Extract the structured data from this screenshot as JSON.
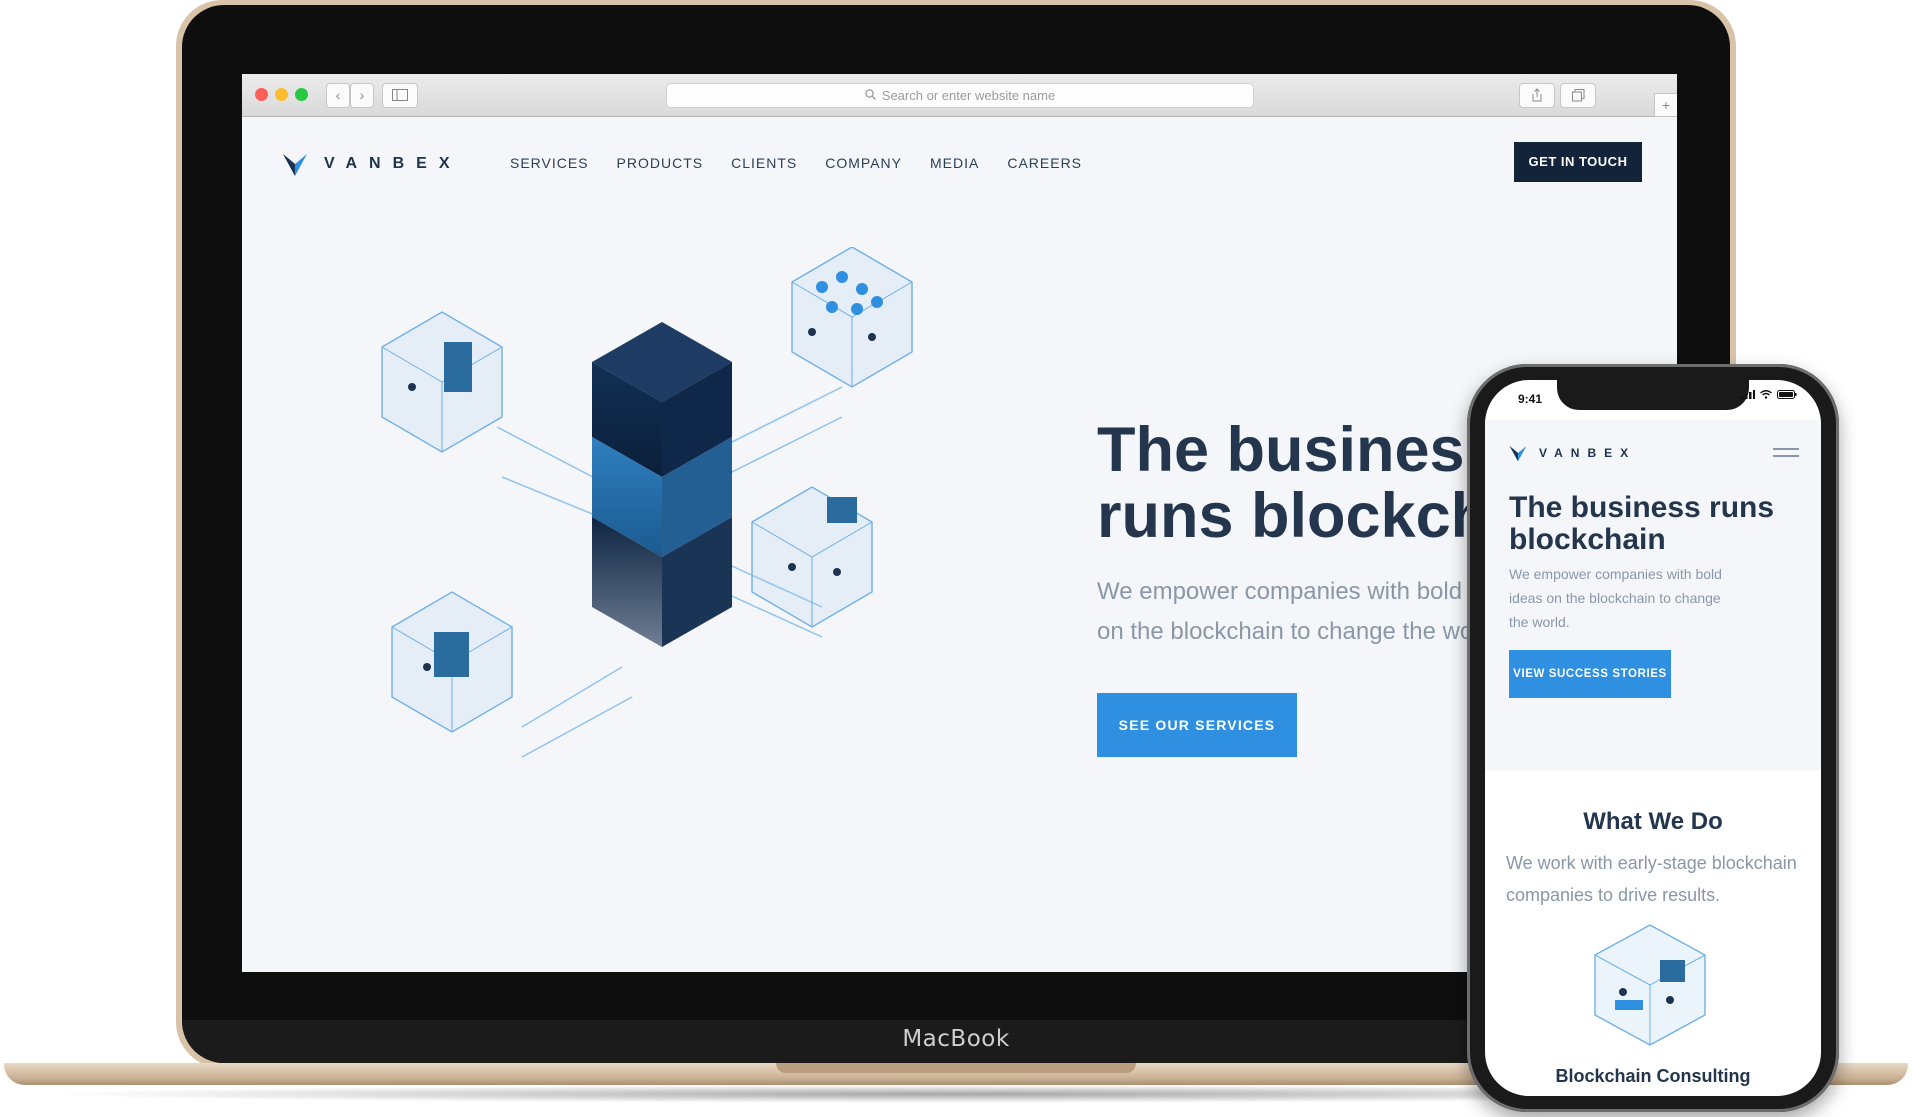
{
  "device": {
    "laptop_brand": "MacBook"
  },
  "browser": {
    "url_placeholder": "Search or enter website name",
    "traffic_lights": [
      "#fc5f57",
      "#fdbc2e",
      "#28c840"
    ]
  },
  "site": {
    "logo_text": "VANBEX",
    "nav": [
      "SERVICES",
      "PRODUCTS",
      "CLIENTS",
      "COMPANY",
      "MEDIA",
      "CAREERS"
    ],
    "cta_label": "GET IN TOUCH",
    "hero": {
      "title_line1": "The business",
      "title_line2": "runs blockchain",
      "subtitle_line1": "We empower companies with bold ideas",
      "subtitle_line2": "on the blockchain to change the world.",
      "button_label": "SEE OUR SERVICES"
    },
    "colors": {
      "navy": "#12233a",
      "accent": "#2f8fe0",
      "heading": "#24364d",
      "muted": "#8a97a8",
      "background": "#f4f6f9"
    }
  },
  "mobile": {
    "status_time": "9:41",
    "logo_text": "VANBEX",
    "hero": {
      "title": "The business runs blockchain",
      "subtitle": "We empower companies with bold ideas on the blockchain to change the world.",
      "button_label": "VIEW SUCCESS STORIES"
    },
    "section": {
      "title": "What We Do",
      "text": "We work with early-stage blockchain companies to drive results.",
      "service_title": "Blockchain Consulting"
    }
  }
}
